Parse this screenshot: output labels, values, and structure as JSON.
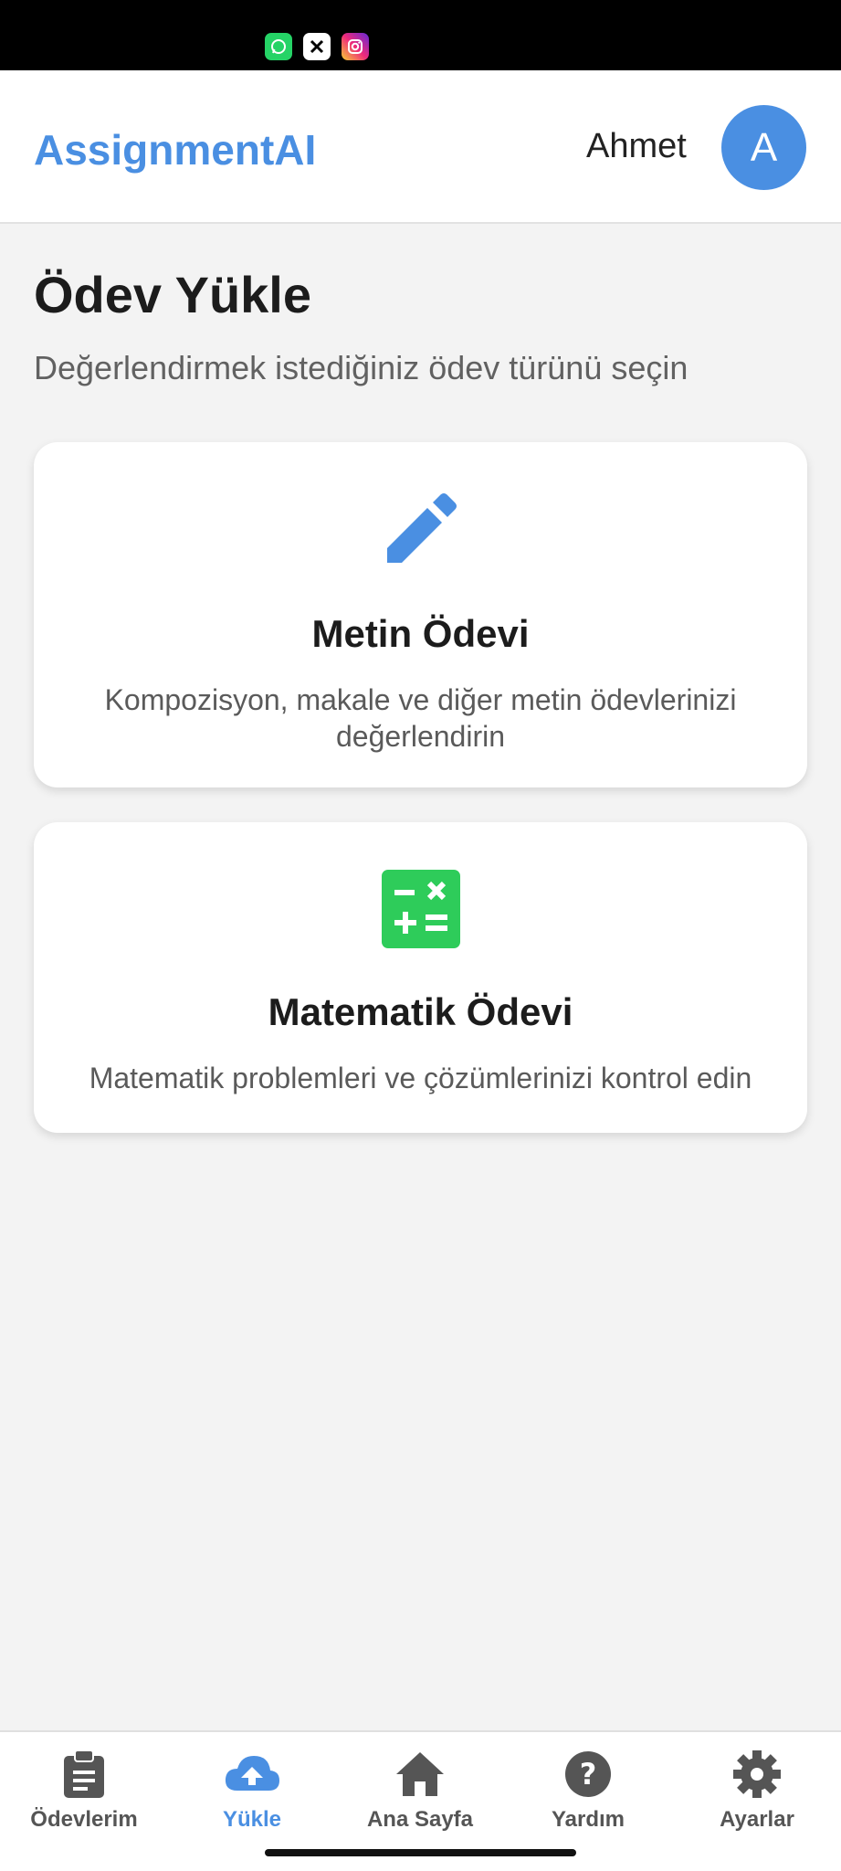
{
  "status_bar": {
    "notification_icons": [
      "whatsapp-icon",
      "x-icon",
      "instagram-icon"
    ]
  },
  "header": {
    "brand": "AssignmentAI",
    "user_name": "Ahmet",
    "avatar_initial": "A"
  },
  "page": {
    "title": "Ödev Yükle",
    "subtitle": "Değerlendirmek istediğiniz ödev türünü seçin"
  },
  "cards": [
    {
      "icon": "pencil-icon",
      "title": "Metin Ödevi",
      "description": "Kompozisyon, makale ve diğer metin ödevlerinizi değerlendirin"
    },
    {
      "icon": "calculator-icon",
      "title": "Matematik Ödevi",
      "description": "Matematik problemleri ve çözümlerinizi kontrol edin"
    }
  ],
  "bottom_nav": {
    "items": [
      {
        "label": "Ödevlerim",
        "icon": "clipboard-icon"
      },
      {
        "label": "Yükle",
        "icon": "cloud-upload-icon",
        "active": true
      },
      {
        "label": "Ana Sayfa",
        "icon": "home-icon"
      },
      {
        "label": "Yardım",
        "icon": "help-icon"
      },
      {
        "label": "Ayarlar",
        "icon": "gear-icon"
      }
    ]
  },
  "colors": {
    "accent": "#4a8fe2",
    "math_icon": "#2ecc5a",
    "background": "#f3f3f3"
  }
}
